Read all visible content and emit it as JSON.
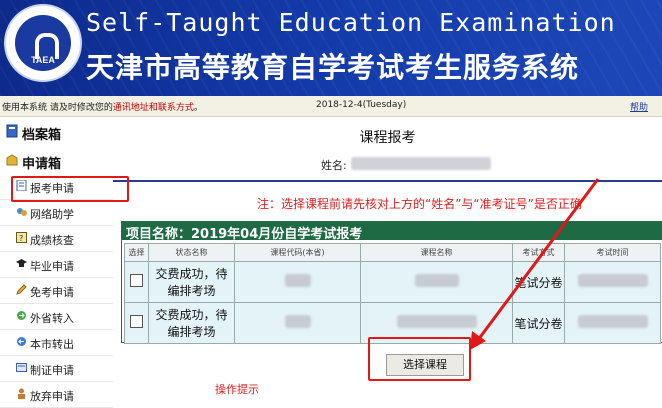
{
  "header": {
    "logo_text": "TAEA",
    "title_en": "Self-Taught Education Examination",
    "title_cn": "天津市高等教育自学考试考生服务系统"
  },
  "infobar": {
    "notice_prefix": "使用本系统 请及时修改您的",
    "notice_link": "通讯地址和联系方式",
    "notice_suffix": "。",
    "date": "2018-12-4(Tuesday)",
    "help": "帮助"
  },
  "sidebar": {
    "sections": [
      {
        "label": "档案箱",
        "icon": "folder-icon"
      },
      {
        "label": "申请箱",
        "icon": "inbox-icon"
      }
    ],
    "items": [
      {
        "label": "报考申请",
        "icon": "document-icon"
      },
      {
        "label": "网络助学",
        "icon": "network-icon"
      },
      {
        "label": "成绩核查",
        "icon": "checkbox-icon"
      },
      {
        "label": "毕业申请",
        "icon": "graduation-cap-icon"
      },
      {
        "label": "免考申请",
        "icon": "pencil-icon"
      },
      {
        "label": "外省转入",
        "icon": "transfer-in-icon"
      },
      {
        "label": "本市转出",
        "icon": "transfer-out-icon"
      },
      {
        "label": "制证申请",
        "icon": "certificate-icon"
      },
      {
        "label": "放弃申请",
        "icon": "person-icon"
      }
    ]
  },
  "main": {
    "title": "课程报考",
    "name_label": "姓名:",
    "warning": "注：选择课程前请先核对上方的“姓名”与“准考证号”是否正确",
    "project_title": "项目名称：2019年04月份自学考试报考",
    "columns": [
      "选择",
      "状态名称",
      "课程代码(本省)",
      "课程名称",
      "考试方式",
      "考试时间"
    ],
    "rows": [
      {
        "status": "交费成功，待编排考场",
        "exam_mode": "笔试分卷"
      },
      {
        "status": "交费成功，待编排考场",
        "exam_mode": "笔试分卷"
      }
    ],
    "select_button": "选择课程",
    "bottom_hint": "操作提示"
  },
  "colors": {
    "header_blue": "#1339a8",
    "panel_green": "#1e6a44",
    "warning_red": "#e02020",
    "annotation_red": "#e01818"
  }
}
